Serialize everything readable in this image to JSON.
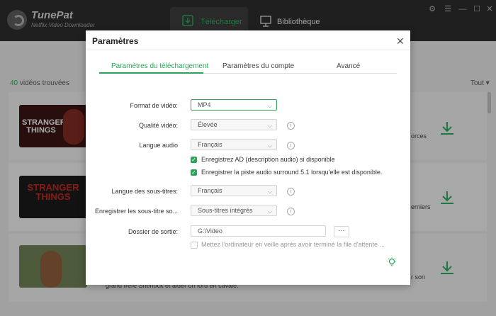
{
  "app": {
    "name": "TunePat",
    "subtitle": "Netflix Video Downloader"
  },
  "nav": {
    "download_tab": "Télécharger",
    "library_tab": "Bibliothèque"
  },
  "list": {
    "count_number": "40",
    "count_label": " vidéos trouvées",
    "sort_label": "Tout",
    "items": [
      {
        "thumb_text": "STRANGER THINGS",
        "side_text": "orces"
      },
      {
        "thumb_text": "STRANGER THINGS",
        "side_text": "erniers"
      },
      {
        "thumb_text": "",
        "side_text": "r son",
        "desc": "grand frère Sherlock et aider un lord en cavale."
      }
    ]
  },
  "dialog": {
    "title": "Paramètres",
    "tabs": [
      "Paramètres du téléchargement",
      "Paramètres du compte",
      "Avancé"
    ],
    "fields": {
      "video_format_label": "Format de vidéo:",
      "video_format_value": "MP4",
      "video_quality_label": "Qualité vidéo:",
      "video_quality_value": "Élevée",
      "audio_lang_label": "Langue audio",
      "audio_lang_value": "Français",
      "ad_checkbox_label": "Enregistrez AD (description audio) si disponible",
      "surround_checkbox_label": "Enregistrer la piste audio surround 5.1 lorsqu'elle est disponible.",
      "subtitle_lang_label": "Langue des sous-titres:",
      "subtitle_lang_value": "Français",
      "save_subtitle_label": "Enregistrer les sous-titre so...",
      "save_subtitle_value": "Sous-titres intégrés",
      "output_folder_label": "Dossier de sortie:",
      "output_folder_value": "G:\\Video",
      "browse_label": "···",
      "sleep_checkbox_label": "Mettez l'ordinateur en veille après avoir terminé la file d'attente ..."
    }
  },
  "colors": {
    "accent": "#2aa65a",
    "titlebar": "#2c2c2c"
  }
}
